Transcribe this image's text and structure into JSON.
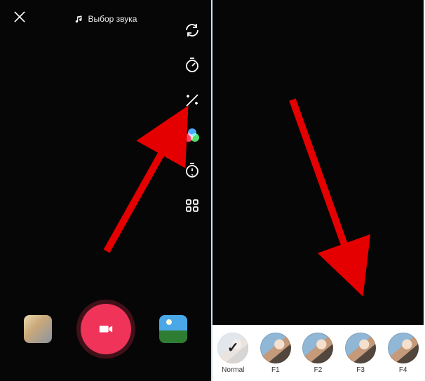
{
  "left": {
    "sound_label": "Выбор звука",
    "tools": {
      "flip": "flip",
      "speed": "speed",
      "beauty": "beauty",
      "filters": "filters",
      "timer": "timer",
      "more": "more"
    }
  },
  "right": {
    "filters": [
      {
        "label": "Normal",
        "selected": true
      },
      {
        "label": "F1",
        "selected": false
      },
      {
        "label": "F2",
        "selected": false
      },
      {
        "label": "F3",
        "selected": false
      },
      {
        "label": "F4",
        "selected": false
      }
    ]
  }
}
